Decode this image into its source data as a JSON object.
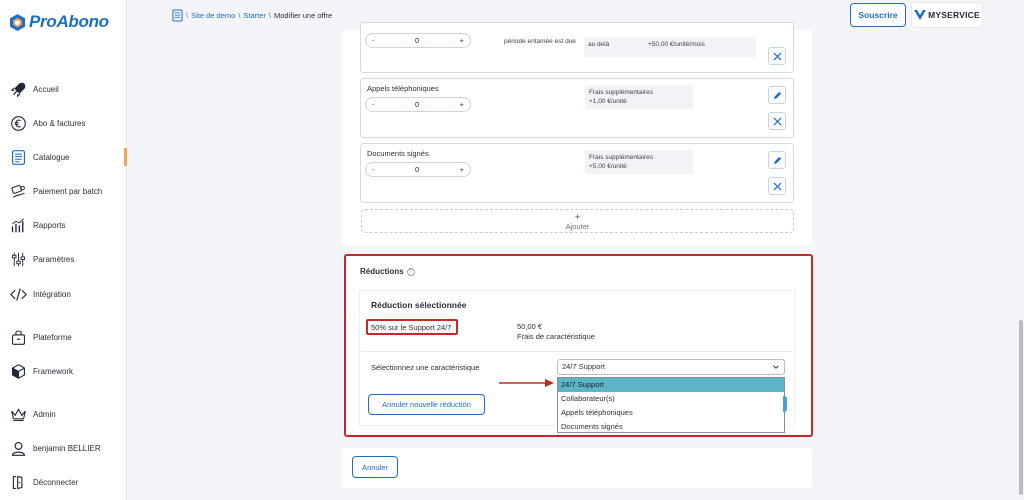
{
  "app": {
    "name": "ProAbono"
  },
  "sidebar": {
    "items": [
      {
        "label": "Accueil",
        "icon": "rocket-icon"
      },
      {
        "label": "Abo & factures",
        "icon": "euro-icon"
      },
      {
        "label": "Catalogue",
        "icon": "catalog-icon"
      },
      {
        "label": "Paiement par batch",
        "icon": "batch-payment-icon"
      },
      {
        "label": "Rapports",
        "icon": "chart-icon"
      },
      {
        "label": "Paramètres",
        "icon": "sliders-icon"
      },
      {
        "label": "Intégration",
        "icon": "code-icon"
      },
      {
        "label": "Plateforme",
        "icon": "platform-icon"
      },
      {
        "label": "Framework",
        "icon": "cube-icon"
      },
      {
        "label": "Admin",
        "icon": "crown-icon"
      },
      {
        "label": "benjamin BELLIER",
        "icon": "user-icon"
      },
      {
        "label": "Déconnecter",
        "icon": "logout-icon"
      }
    ]
  },
  "header": {
    "breadcrumb": {
      "site": "Site de demo",
      "offer": "Starter",
      "current": "Modifier une offre",
      "sep": "\\"
    },
    "subscribe": "Souscrire",
    "brand": "MYSERVICE"
  },
  "features": [
    {
      "name": "",
      "qty": "0",
      "minus": "-",
      "plus": "+",
      "desc": "période entamée est due",
      "fee_line1": "au delà",
      "fee_line2": "+50,00 €/unité/mois"
    },
    {
      "name": "Appels téléphoniques",
      "qty": "0",
      "minus": "-",
      "plus": "+",
      "fee_line1": "Frais supplémentaires",
      "fee_line2": "+1,00 €/unité"
    },
    {
      "name": "Documents signés",
      "qty": "0",
      "minus": "-",
      "plus": "+",
      "fee_line1": "Frais supplémentaires",
      "fee_line2": "+5,00 €/unité"
    }
  ],
  "add": {
    "plus": "+",
    "label": "Ajouter"
  },
  "reductions": {
    "title": "Réductions",
    "help": "?",
    "selected_title": "Réduction sélectionnée",
    "selected_value": "50% sur le Support 24/7",
    "price": "50,00 €",
    "price_label": "Frais de caractéristique",
    "select_label": "Sélectionnez une caractéristique",
    "select_value": "24/7 Support",
    "options": [
      "24/7 Support",
      "Collaborateur(s)",
      "Appels téléphoniques",
      "Documents signés"
    ],
    "cancel_new": "Annuler nouvelle réduction"
  },
  "footer": {
    "cancel": "Annuler"
  },
  "colors": {
    "accent": "#1e6ec8",
    "highlight": "#c62828",
    "selected_option": "#5bb4c8"
  }
}
